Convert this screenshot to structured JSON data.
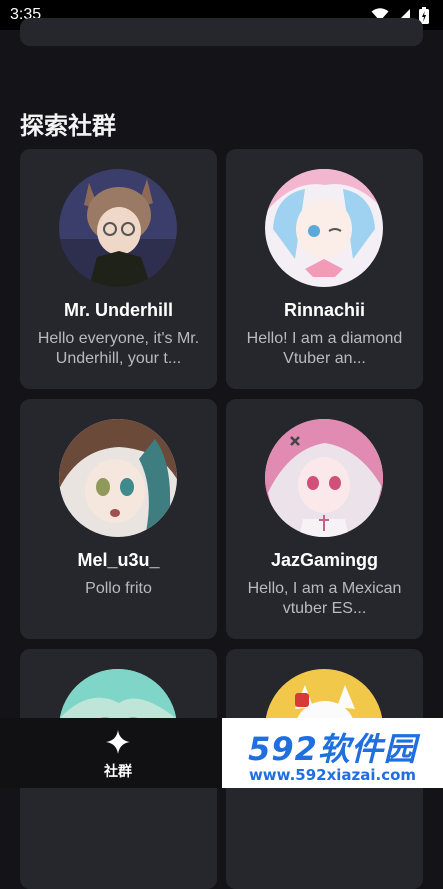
{
  "status_bar": {
    "time": "3:35"
  },
  "section": {
    "title": "探索社群"
  },
  "communities": [
    {
      "name": "Mr. Underhill",
      "description": "Hello everyone, it's Mr. Underhill, your t..."
    },
    {
      "name": "Rinnachii",
      "description": "Hello! I am a diamond Vtuber an..."
    },
    {
      "name": "Mel_u3u_",
      "description": "Pollo frito"
    },
    {
      "name": "JazGamingg",
      "description": "Hello, I am a Mexican vtuber ES..."
    },
    {
      "name": "",
      "description": ""
    },
    {
      "name": "",
      "description": ""
    }
  ],
  "bottom_nav": {
    "community_label": "社群",
    "icon": "sparkle-icon"
  },
  "watermark": {
    "brand": "592软件园",
    "url": "www.592xiazai.com"
  },
  "colors": {
    "background": "#141418",
    "card": "#26262d",
    "watermark_blue": "#1f6fe0"
  }
}
